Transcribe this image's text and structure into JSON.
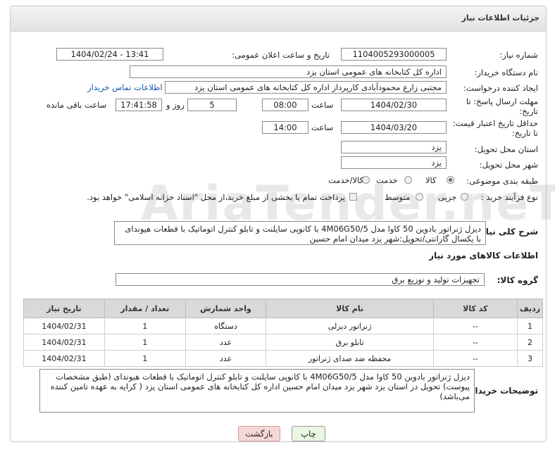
{
  "panel": {
    "title": "جزئیات اطلاعات نیاز"
  },
  "form": {
    "need_number": {
      "label": "شماره نیاز:",
      "value": "1104005293000005"
    },
    "announce_datetime": {
      "label": "تاریخ و ساعت اعلان عمومی:",
      "value": "1404/02/24 - 13:41"
    },
    "buyer_org": {
      "label": "نام دستگاه خریدار:",
      "value": "اداره کل کتابخانه های عمومی استان یزد"
    },
    "requester": {
      "label": "ایجاد کننده درخواست:",
      "value": "مجتبی زارع محمودآبادی کارپرداز اداره کل کتابخانه های عمومی استان یزد",
      "contact_link": "اطلاعات تماس خریدار"
    },
    "reply_deadline": {
      "label_line1": "مهلت ارسال پاسخ: تا",
      "label_line2": "تاریخ:",
      "date": "1404/02/30",
      "time_label": "ساعت",
      "time": "08:00",
      "days": "5",
      "days_label": "روز و",
      "remaining": "17:41:58",
      "remaining_label": "ساعت باقی مانده"
    },
    "price_validity": {
      "label_line1": "حداقل تاریخ اعتبار قیمت:",
      "label_line2": "تا تاریخ:",
      "date": "1404/03/20",
      "time_label": "ساعت",
      "time": "14:00"
    },
    "delivery_province": {
      "label": "استان محل تحویل:",
      "value": "یزد"
    },
    "delivery_city": {
      "label": "شهر محل تحویل:",
      "value": "یزد"
    },
    "category": {
      "label": "طبقه بندی موضوعی:",
      "options": [
        "کالا",
        "خدمت",
        "کالا/خدمت"
      ],
      "selected": "کالا"
    },
    "purchase_type": {
      "label": "نوع فرآیند خرید :",
      "options": [
        "جزیی",
        "متوسط"
      ],
      "selected": "",
      "payment_note": "پرداخت تمام یا بخشی از مبلغ خرید،از محل \"اسناد خزانه اسلامی\" خواهد بود."
    }
  },
  "description": {
    "label": "شرح کلی نیاز:",
    "text": "دیزل ژنراتور بادوین 50 کاوا مدل 4M06G50/5 با کانوپی سایلنت و تابلو کنترل اتوماتیک با قطعات هیوندای با یکسال گارانتی/تحویل:شهر یزد میدان امام حسین"
  },
  "goods": {
    "section_title": "اطلاعات کالاهای مورد نیاز",
    "group_label": "گروه کالا:",
    "group_value": "تجهیزات تولید و توزیع برق",
    "columns": [
      "ردیف",
      "کد کالا",
      "نام کالا",
      "واحد شمارش",
      "تعداد / مقدار",
      "تاریخ نیاز"
    ],
    "rows": [
      [
        "1",
        "--",
        "ژنراتور دیزلی",
        "دستگاه",
        "1",
        "1404/02/31"
      ],
      [
        "2",
        "--",
        "تابلو برق",
        "عدد",
        "1",
        "1404/02/31"
      ],
      [
        "3",
        "--",
        "محفظه ضد صدای ژنراتور",
        "عدد",
        "1",
        "1404/02/31"
      ]
    ]
  },
  "buyer_notes": {
    "label": "توضیحات خریدار:",
    "text": "دیزل ژنراتور بادوین 50 کاوا مدل 4M06G50/5 با کانوپی سایلنت و تابلو کنترل اتوماتیک با قطعات هیوندای (طبق مشخصات پیوست) تحویل در استان یزد شهر یزد میدان امام حسین اداره کل کتابخانه های عمومی استان یزد ( کرایه به عهده تامین کننده می‌باشد)"
  },
  "buttons": {
    "print": "چاپ",
    "back": "بازگشت"
  },
  "colors": {
    "back_button": "#f6d8d8",
    "print_button": "#e9f7e2",
    "link": "#1a55b0",
    "table_header": "#d9d9d9"
  },
  "watermark": "AriaTender.neT"
}
